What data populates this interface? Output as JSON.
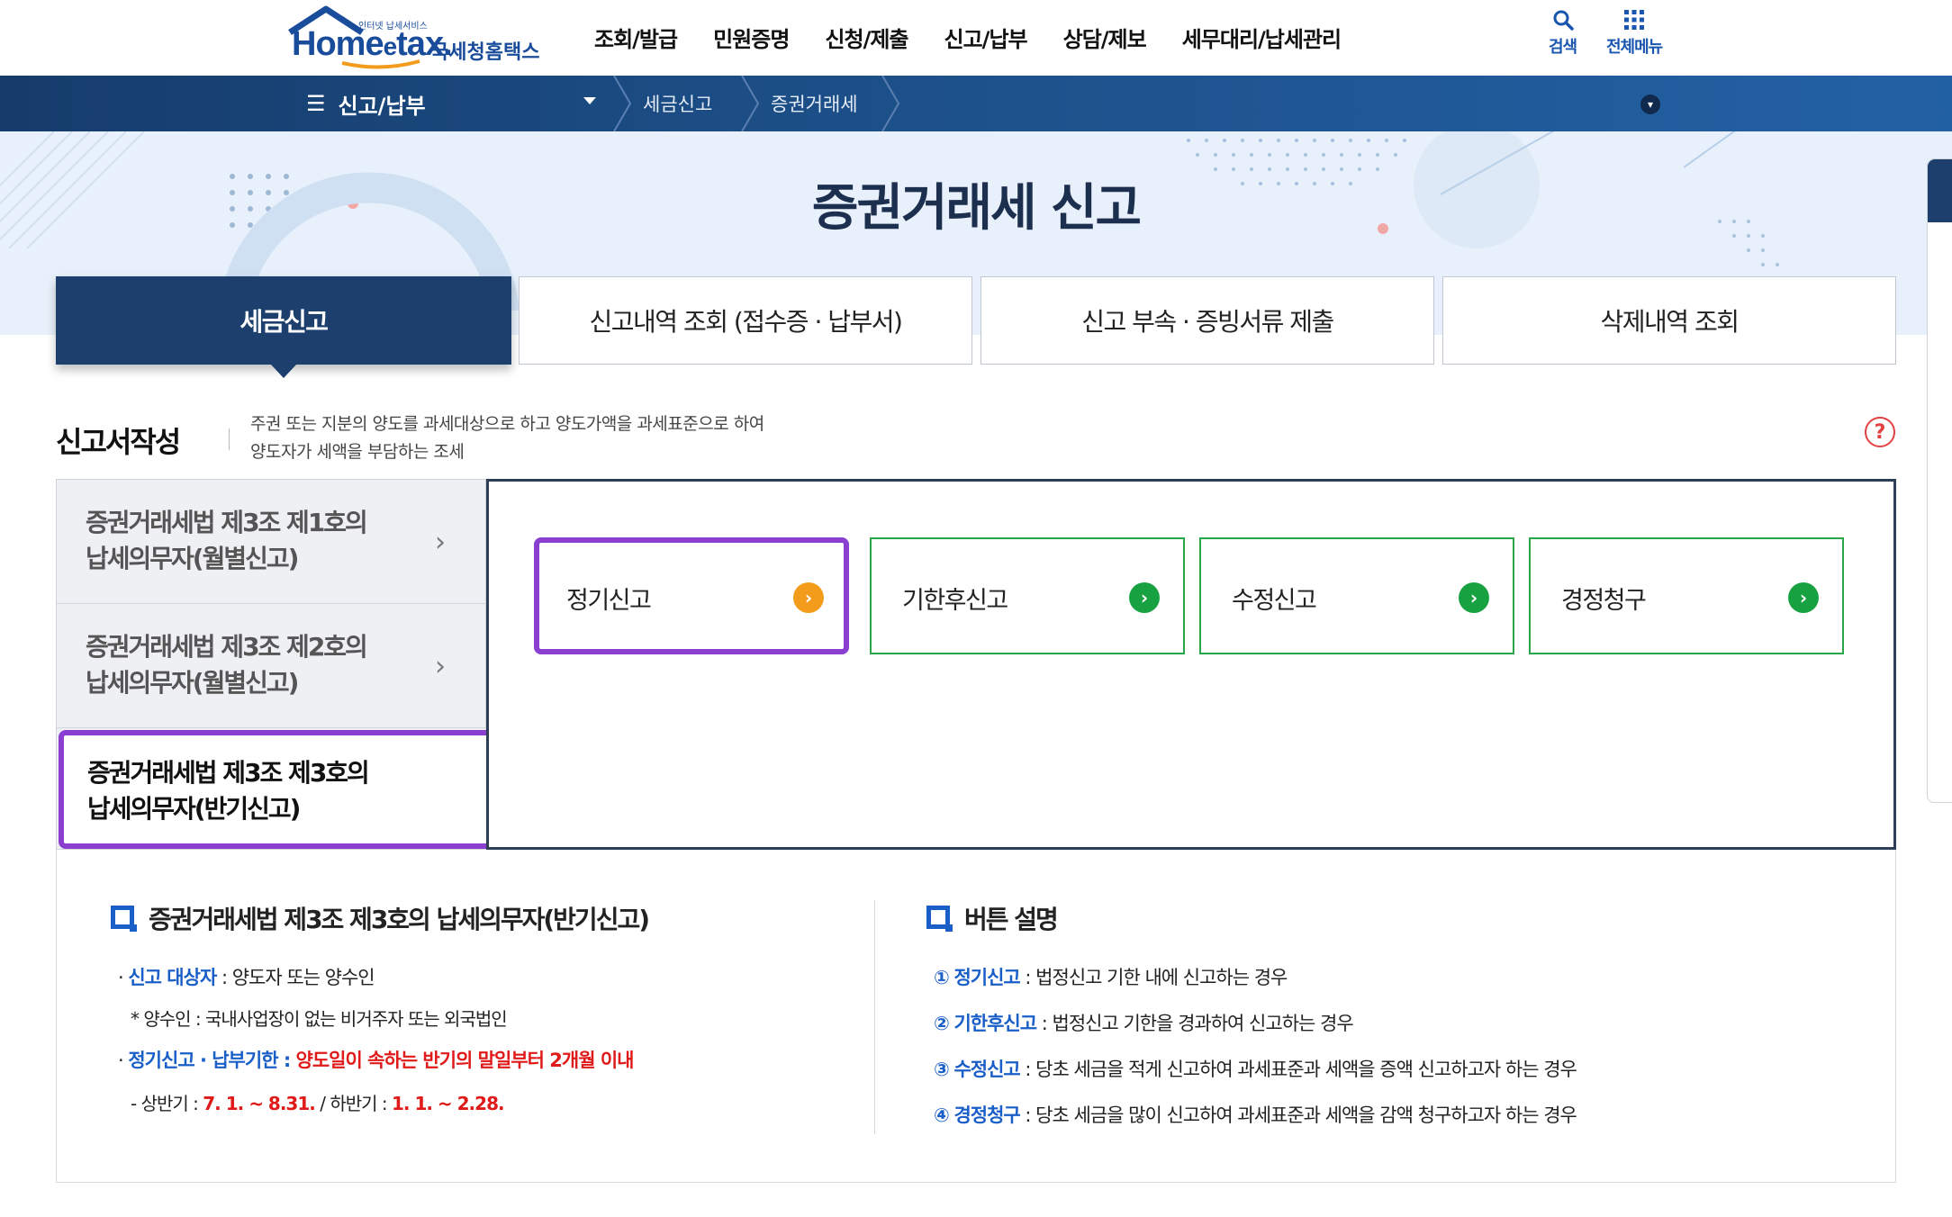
{
  "header": {
    "logo_tag": "인터넷 납세서비스",
    "logo_home": "Home",
    "logo_e": "e",
    "logo_tax": "tax.",
    "logo_name": "국세청홈택스",
    "menu": [
      "조회/발급",
      "민원증명",
      "신청/제출",
      "신고/납부",
      "상담/제보",
      "세무대리/납세관리"
    ],
    "search_label": "검색",
    "allmenu_label": "전체메뉴"
  },
  "navbar": {
    "menu_label": "신고/납부",
    "breadcrumb": [
      "세금신고",
      "증권거래세"
    ]
  },
  "hero": {
    "title": "증권거래세 신고"
  },
  "tabs": [
    {
      "label": "세금신고",
      "active": true
    },
    {
      "label": "신고내역 조회 (접수증 · 납부서)",
      "active": false
    },
    {
      "label": "신고 부속 · 증빙서류 제출",
      "active": false
    },
    {
      "label": "삭제내역 조회",
      "active": false
    }
  ],
  "section": {
    "title": "신고서작성",
    "desc_line1": "주권 또는 지분의 양도를 과세대상으로 하고 양도가액을 과세표준으로 하여",
    "desc_line2": "양도자가 세액을 부담하는 조세",
    "help": "?"
  },
  "left_list": [
    {
      "line1": "증권거래세법 제3조 제1호의",
      "line2": "납세의무자(월별신고)",
      "selected": false
    },
    {
      "line1": "증권거래세법 제3조 제2호의",
      "line2": "납세의무자(월별신고)",
      "selected": false
    },
    {
      "line1": "증권거래세법 제3조 제3호의",
      "line2": "납세의무자(반기신고)",
      "selected": true
    }
  ],
  "options": [
    {
      "label": "정기신고",
      "selected": true
    },
    {
      "label": "기한후신고",
      "selected": false
    },
    {
      "label": "수정신고",
      "selected": false
    },
    {
      "label": "경정청구",
      "selected": false
    }
  ],
  "info_left": {
    "heading": "증권거래세법 제3조 제3호의 납세의무자(반기신고)",
    "target_label": "신고 대상자",
    "target_text": " : 양도자 또는 양수인",
    "note": "* 양수인 : 국내사업장이 없는 비거주자 또는 외국법인",
    "deadline_label": "정기신고 · 납부기한 :",
    "deadline_text": " 양도일이 속하는 반기의 말일부터 2개월 이내",
    "period_prefix": "- 상반기 : ",
    "period_h1": "7. 1. ~ 8.31.",
    "period_mid": " / 하반기 : ",
    "period_h2": "1. 1. ~ 2.28."
  },
  "info_right": {
    "heading": "버튼 설명",
    "items": [
      {
        "num": "①",
        "label": "정기신고",
        "text": " : 법정신고 기한 내에 신고하는 경우"
      },
      {
        "num": "②",
        "label": "기한후신고",
        "text": " : 법정신고 기한을 경과하여 신고하는 경우"
      },
      {
        "num": "③",
        "label": "수정신고",
        "text": " : 당초 세금을 적게 신고하여 과세표준과 세액을 증액 신고하고자 하는 경우"
      },
      {
        "num": "④",
        "label": "경정청구",
        "text": " : 당초 세금을 많이 신고하여 과세표준과 세액을 감액 청구하고자 하는 경우"
      }
    ]
  },
  "colors": {
    "navy": "#1d3f6e",
    "selection": "#8a3fd0",
    "green": "#18a141",
    "orange": "#f39b1b",
    "blue_text": "#1a5ec7",
    "red_text": "#e01919"
  }
}
